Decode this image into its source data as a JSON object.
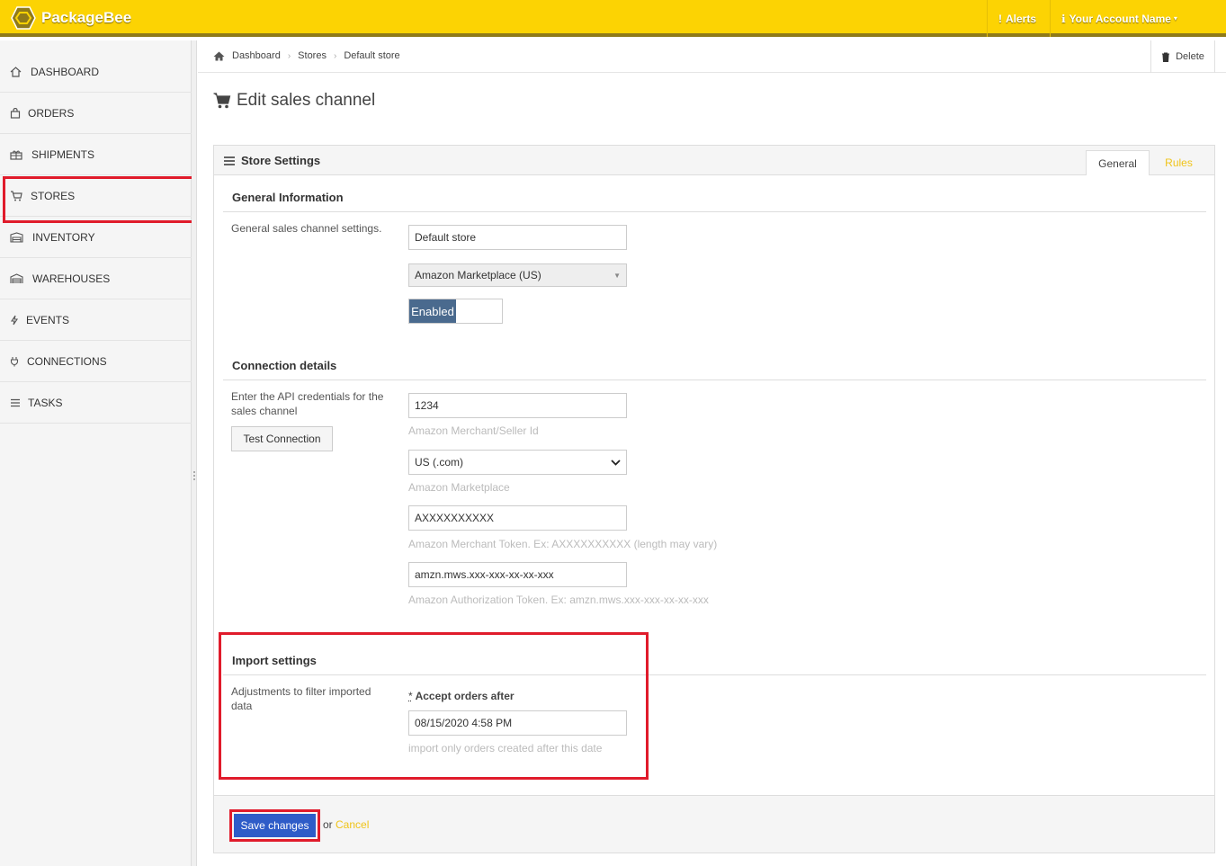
{
  "app": {
    "brand": "PackageBee"
  },
  "topnav": {
    "alerts": "Alerts",
    "account": "Your Account Name"
  },
  "sidebar": {
    "items": [
      {
        "label": "DASHBOARD",
        "icon": "home-icon"
      },
      {
        "label": "ORDERS",
        "icon": "bag-icon"
      },
      {
        "label": "SHIPMENTS",
        "icon": "gift-icon"
      },
      {
        "label": "STORES",
        "icon": "cart-icon"
      },
      {
        "label": "INVENTORY",
        "icon": "warehouse-icon"
      },
      {
        "label": "WAREHOUSES",
        "icon": "garage-icon"
      },
      {
        "label": "EVENTS",
        "icon": "bolt-icon"
      },
      {
        "label": "CONNECTIONS",
        "icon": "plug-icon"
      },
      {
        "label": "TASKS",
        "icon": "list-icon"
      }
    ]
  },
  "breadcrumb": {
    "items": [
      "Dashboard",
      "Stores",
      "Default store"
    ]
  },
  "toolbar": {
    "delete_label": "Delete"
  },
  "page": {
    "title": "Edit sales channel"
  },
  "panel": {
    "title": "Store Settings",
    "tabs": {
      "general": "General",
      "rules": "Rules"
    }
  },
  "general_info": {
    "title": "General Information",
    "description": "General sales channel settings.",
    "store_name": "Default store",
    "channel_type": "Amazon Marketplace (US)",
    "status": "Enabled"
  },
  "connection": {
    "title": "Connection details",
    "description": "Enter the API credentials for the sales channel",
    "test_button": "Test Connection",
    "merchant_id": "1234",
    "merchant_id_help": "Amazon Merchant/Seller Id",
    "marketplace": "US (.com)",
    "marketplace_help": "Amazon Marketplace",
    "merchant_token": "AXXXXXXXXXX",
    "merchant_token_help": "Amazon Merchant Token. Ex: AXXXXXXXXXX (length may vary)",
    "auth_token": "amzn.mws.xxx-xxx-xx-xx-xxx",
    "auth_token_help": "Amazon Authorization Token. Ex: amzn.mws.xxx-xxx-xx-xx-xxx"
  },
  "import": {
    "title": "Import settings",
    "description": "Adjustments to filter imported data",
    "required_marker": "*",
    "accept_label": "Accept orders after",
    "accept_value": "08/15/2020 4:58 PM",
    "accept_help": "import only orders created after this date"
  },
  "footer": {
    "save": "Save changes",
    "or": "or",
    "cancel": "Cancel"
  },
  "colors": {
    "brand_yellow": "#fcd303",
    "highlight_red": "#e01b2b",
    "save_blue": "#2e5cc8",
    "link_yellow": "#f0c419",
    "toggle_on": "#4a6a8e"
  }
}
